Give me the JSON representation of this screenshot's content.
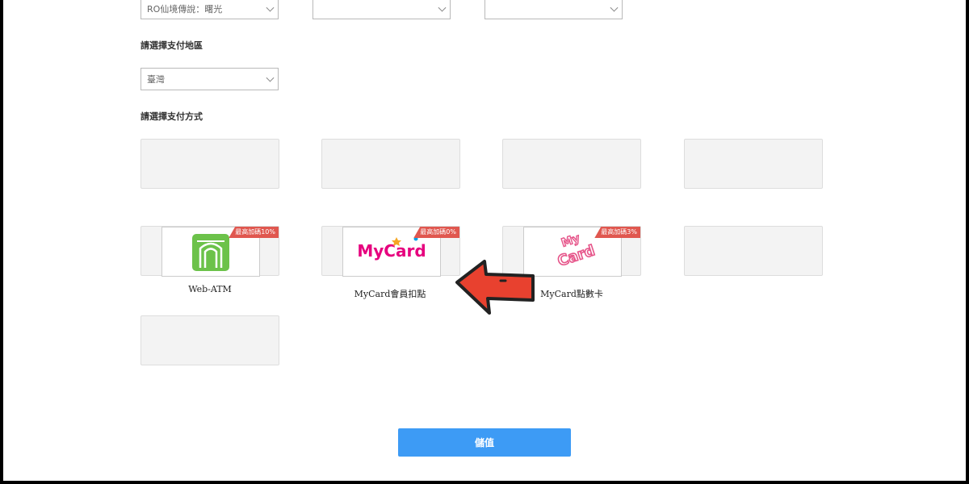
{
  "top_selects": [
    {
      "value": "RO仙境傳說：曙光"
    },
    {
      "value": ""
    },
    {
      "value": ""
    }
  ],
  "region": {
    "label": "請選擇支付地區",
    "value": "臺灣"
  },
  "payment": {
    "label": "請選擇支付方式",
    "methods": [
      {
        "name": "Web-ATM",
        "badge": "最高加碼10%"
      },
      {
        "name": "MyCard會員扣點",
        "badge": "最高加碼0%"
      },
      {
        "name": "MyCard點數卡",
        "badge": "最高加碼3%"
      }
    ]
  },
  "logos": {
    "mycard_logo_text": "MyCard",
    "mycard_card_text_1": "My",
    "mycard_card_text_2": "Card"
  },
  "colors": {
    "submit_button": "#3d9bf5",
    "badge": "#e0574f",
    "arrow": "#e8412f",
    "webatm_green": "#6cc24a"
  },
  "submit": {
    "label": "儲值"
  }
}
